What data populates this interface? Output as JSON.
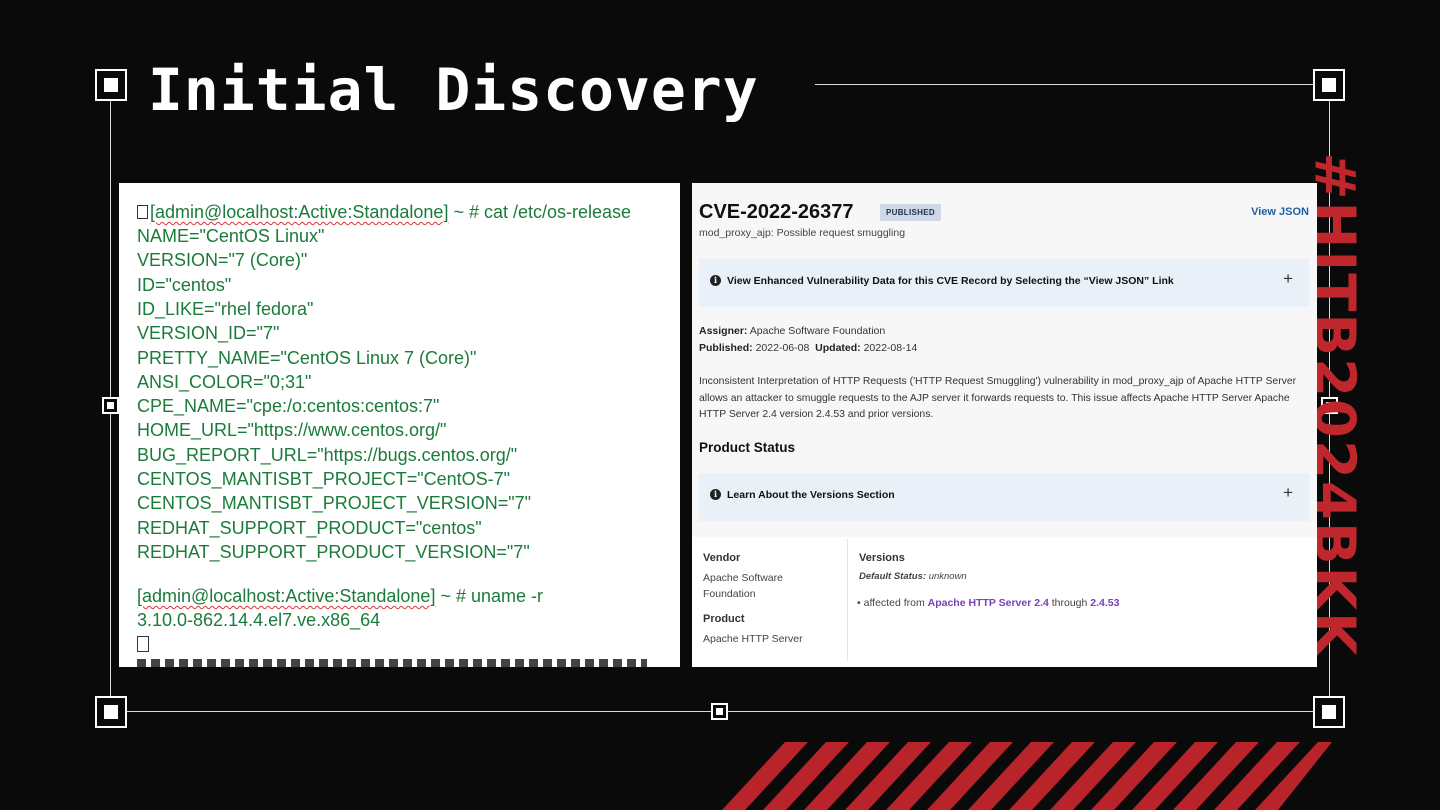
{
  "slide": {
    "title": "Initial Discovery",
    "hashtag": "#HITB2024BKK"
  },
  "colors": {
    "background": "#0a0a0b",
    "accent_red": "#c0272d",
    "terminal_text": "#1b7b3a",
    "link_blue": "#1f5fa8",
    "link_purple": "#7a3fb6"
  },
  "terminal": {
    "prompt_line_1": {
      "prompt": "[admin@localhost:Active:Standalone]",
      "command": " ~ # cat /etc/os-release"
    },
    "os_release_lines": [
      "NAME=\"CentOS Linux\"",
      "VERSION=\"7 (Core)\"",
      "ID=\"centos\"",
      "ID_LIKE=\"rhel fedora\"",
      "VERSION_ID=\"7\"",
      "PRETTY_NAME=\"CentOS Linux 7 (Core)\"",
      "ANSI_COLOR=\"0;31\"",
      "CPE_NAME=\"cpe:/o:centos:centos:7\"",
      "HOME_URL=\"https://www.centos.org/\"",
      "BUG_REPORT_URL=\"https://bugs.centos.org/\"",
      "CENTOS_MANTISBT_PROJECT=\"CentOS-7\"",
      "CENTOS_MANTISBT_PROJECT_VERSION=\"7\"",
      "REDHAT_SUPPORT_PRODUCT=\"centos\"",
      "REDHAT_SUPPORT_PRODUCT_VERSION=\"7\""
    ],
    "prompt_line_2": {
      "prompt": "[admin@localhost:Active:Standalone]",
      "command": " ~ # uname -r"
    },
    "uname_output": "3.10.0-862.14.4.el7.ve.x86_64"
  },
  "cve": {
    "id": "CVE-2022-26377",
    "status_badge": "PUBLISHED",
    "view_json": "View JSON",
    "subtitle": "mod_proxy_ajp: Possible request smuggling",
    "enhanced_banner": "View Enhanced Vulnerability Data for this CVE Record by Selecting the “View JSON” Link",
    "assigner_label": "Assigner:",
    "assigner_value": "Apache Software Foundation",
    "published_label": "Published:",
    "published_value": "2022-06-08",
    "updated_label": "Updated:",
    "updated_value": "2022-08-14",
    "description": "Inconsistent Interpretation of HTTP Requests ('HTTP Request Smuggling') vulnerability in mod_proxy_ajp of Apache HTTP Server allows an attacker to smuggle requests to the AJP server it forwards requests to. This issue affects Apache HTTP Server Apache HTTP Server 2.4 version 2.4.53 and prior versions.",
    "product_status_heading": "Product Status",
    "versions_banner": "Learn About the Versions Section",
    "vendor_label": "Vendor",
    "vendor_value_1": "Apache Software",
    "vendor_value_2": "Foundation",
    "product_label": "Product",
    "product_value": "Apache HTTP Server",
    "versions_label": "Versions",
    "default_status_label": "Default Status:",
    "default_status_value": "unknown",
    "affected_prefix": "affected from",
    "affected_from": "Apache HTTP Server 2.4",
    "affected_through_word": "through",
    "affected_to": "2.4.53"
  }
}
